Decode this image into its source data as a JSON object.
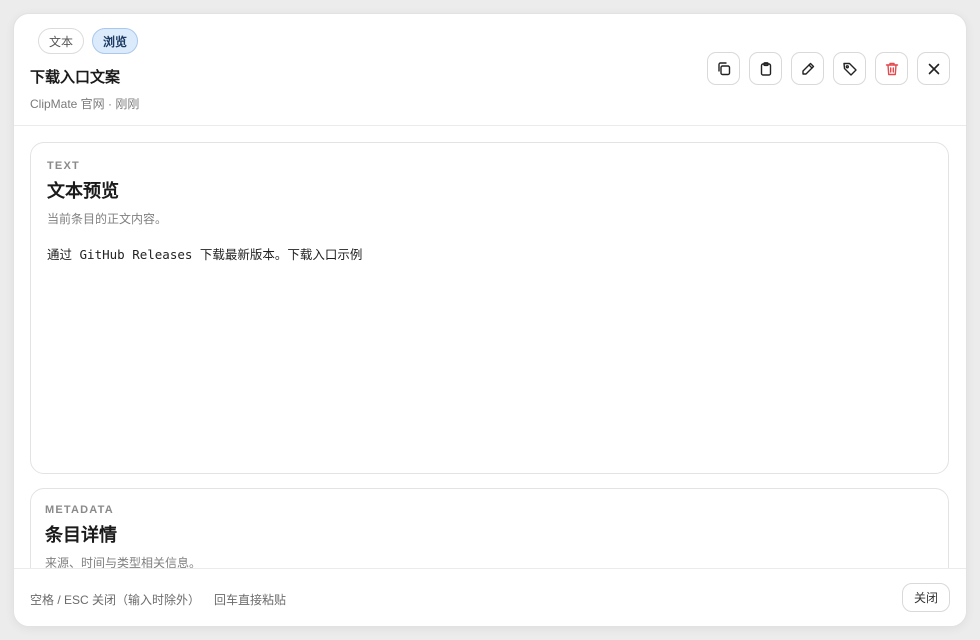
{
  "header": {
    "tabs": [
      {
        "label": "文本",
        "active": false
      },
      {
        "label": "浏览",
        "active": true
      }
    ],
    "title": "下载入口文案",
    "subtitle": "ClipMate 官网 · 刚刚"
  },
  "toolbar": {
    "buttons": [
      {
        "name": "copy",
        "icon": "copy-icon"
      },
      {
        "name": "paste",
        "icon": "clipboard-icon"
      },
      {
        "name": "edit",
        "icon": "pencil-icon"
      },
      {
        "name": "tag",
        "icon": "tag-icon"
      },
      {
        "name": "delete",
        "icon": "trash-icon"
      },
      {
        "name": "close",
        "icon": "close-icon"
      }
    ],
    "danger_color": "#e5484d"
  },
  "preview": {
    "eyebrow": "TEXT",
    "title": "文本预览",
    "description": "当前条目的正文内容。",
    "body": "通过 GitHub Releases 下载最新版本。下载入口示例"
  },
  "metadata": {
    "eyebrow": "METADATA",
    "title": "条目详情",
    "description": "来源、时间与类型相关信息。"
  },
  "footer": {
    "hint_close": "空格 / ESC 关闭（输入时除外）",
    "hint_paste": "回车直接粘贴",
    "close_label": "关闭"
  },
  "colors": {
    "accent_bg": "#dcebfb",
    "accent_border": "#a9c8ee"
  }
}
